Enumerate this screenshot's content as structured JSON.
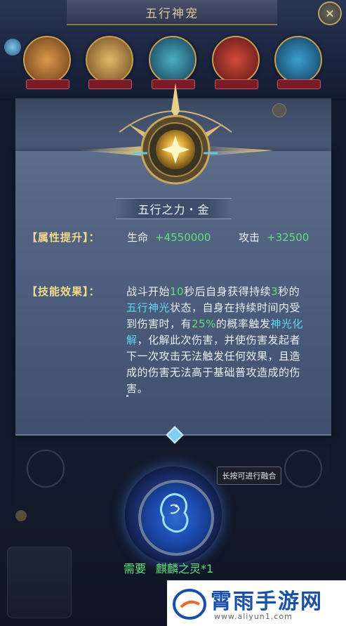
{
  "header": {
    "title": "五行神宠",
    "close_icon": "close-icon"
  },
  "panel": {
    "name": "五行之力・金",
    "attr": {
      "label": "【属性提升】：",
      "stat1_name": "生命",
      "stat1_value": "+4550000",
      "stat2_name": "攻击",
      "stat2_value": "+32500"
    },
    "skill": {
      "label": "【技能效果】：",
      "parts": [
        {
          "t": "战斗开始",
          "c": "w"
        },
        {
          "t": "10",
          "c": "g"
        },
        {
          "t": "秒后自身获得持续",
          "c": "w"
        },
        {
          "t": "3",
          "c": "g"
        },
        {
          "t": "秒的",
          "c": "w"
        },
        {
          "t": "五行神光",
          "c": "c"
        },
        {
          "t": "状态，自身在持续时间内受到伤害时，有",
          "c": "w"
        },
        {
          "t": "25%",
          "c": "g"
        },
        {
          "t": "的概率触发",
          "c": "w"
        },
        {
          "t": "神光化解",
          "c": "c"
        },
        {
          "t": "，化解此次伤害，并使伤害发起者下一次攻击无法触发任何效果，且造成的伤害无法高于基础普攻造成的伤害。",
          "c": "w"
        }
      ]
    }
  },
  "fusion": {
    "tooltip": "长按可进行融合",
    "need_label": "需要",
    "need_item": "麒麟之灵*1"
  },
  "watermark": {
    "title": "霄雨手游网",
    "url": "www.aliyun1.com"
  },
  "colors": {
    "green": "#5fe07a",
    "cyan": "#5ed6f0",
    "gold": "#f2d98b"
  }
}
